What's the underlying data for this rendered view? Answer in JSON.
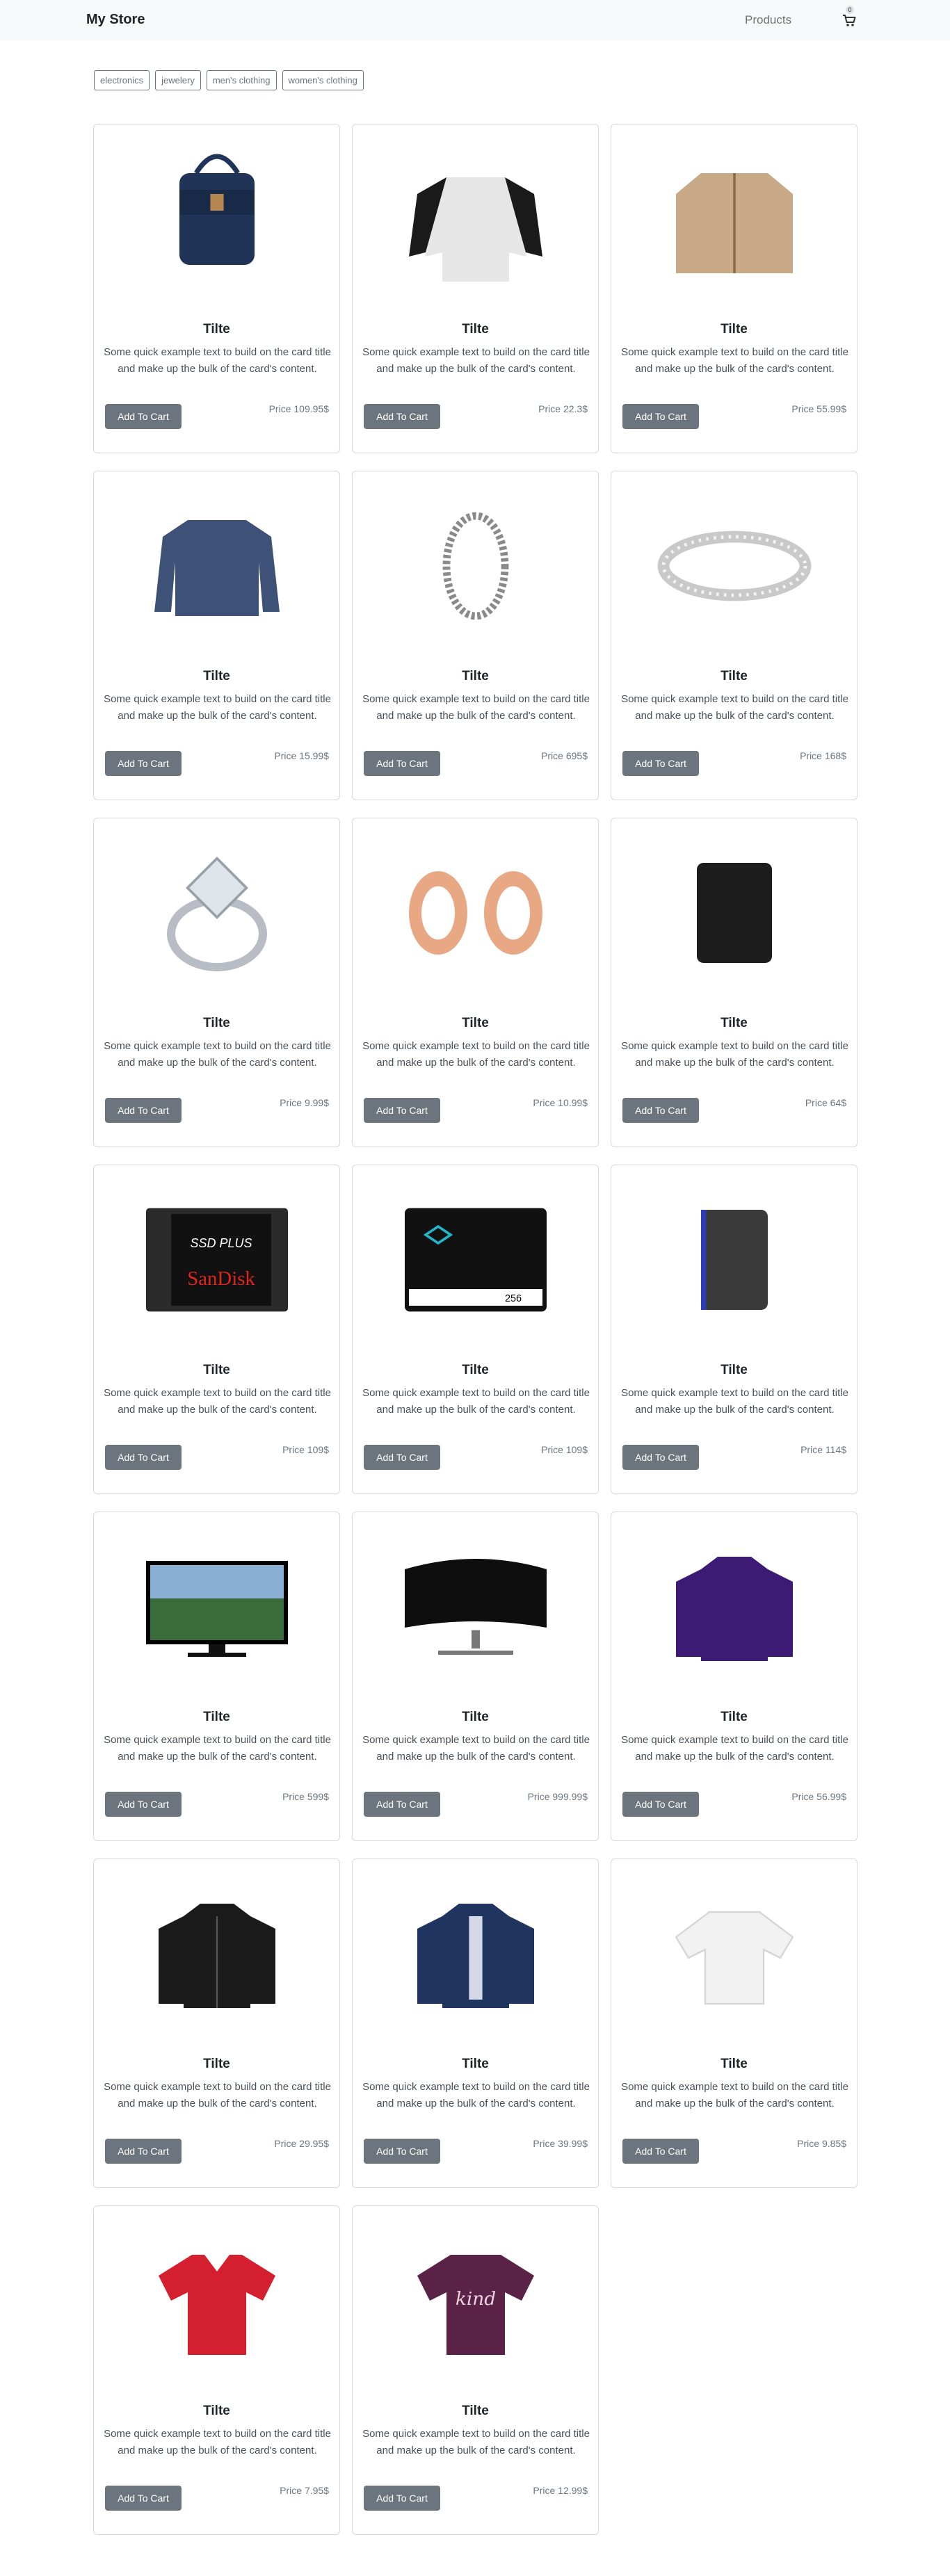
{
  "navbar": {
    "brand": "My Store",
    "products_link": "Products",
    "cart_count": "0"
  },
  "filters": [
    "electronics",
    "jewelery",
    "men's clothing",
    "women's clothing"
  ],
  "card_text": "Some quick example text to build on the card title and make up the bulk of the card's content.",
  "add_to_cart_label": "Add To Cart",
  "products": [
    {
      "title": "Tilte",
      "price": "Price 109.95$",
      "icon": "backpack",
      "color": "#1f3457"
    },
    {
      "title": "Tilte",
      "price": "Price 22.3$",
      "icon": "raglan-tshirt",
      "color": "#e6e6e6"
    },
    {
      "title": "Tilte",
      "price": "Price 55.99$",
      "icon": "cotton-jacket",
      "color": "#c8a987"
    },
    {
      "title": "Tilte",
      "price": "Price 15.99$",
      "icon": "long-sleeve-shirt",
      "color": "#3e5278"
    },
    {
      "title": "Tilte",
      "price": "Price 695$",
      "icon": "chain-bracelet",
      "color": "#8a8a8a"
    },
    {
      "title": "Tilte",
      "price": "Price 168$",
      "icon": "silver-ring",
      "color": "#c9c9c9"
    },
    {
      "title": "Tilte",
      "price": "Price 9.99$",
      "icon": "diamond-ring",
      "color": "#b8bcc4"
    },
    {
      "title": "Tilte",
      "price": "Price 10.99$",
      "icon": "rose-gold-plugs",
      "color": "#e9a884"
    },
    {
      "title": "Tilte",
      "price": "Price 64$",
      "icon": "external-hard-drive",
      "color": "#1d1d1d"
    },
    {
      "title": "Tilte",
      "price": "Price 109$",
      "icon": "ssd-drive",
      "color": "#2b2b2b"
    },
    {
      "title": "Tilte",
      "price": "Price 109$",
      "icon": "ssd-drive-dark",
      "color": "#111111"
    },
    {
      "title": "Tilte",
      "price": "Price 114$",
      "icon": "portable-drive",
      "color": "#2a3cb8"
    },
    {
      "title": "Tilte",
      "price": "Price 599$",
      "icon": "monitor",
      "color": "#3a6c3a"
    },
    {
      "title": "Tilte",
      "price": "Price 999.99$",
      "icon": "curved-monitor",
      "color": "#0e0e0e"
    },
    {
      "title": "Tilte",
      "price": "Price 56.99$",
      "icon": "purple-jacket",
      "color": "#3d1a73"
    },
    {
      "title": "Tilte",
      "price": "Price 29.95$",
      "icon": "leather-jacket",
      "color": "#1a1a1a"
    },
    {
      "title": "Tilte",
      "price": "Price 39.99$",
      "icon": "rain-jacket",
      "color": "#1f3560"
    },
    {
      "title": "Tilte",
      "price": "Price 9.85$",
      "icon": "white-top",
      "color": "#f2f2f2"
    },
    {
      "title": "Tilte",
      "price": "Price 7.95$",
      "icon": "red-tshirt",
      "color": "#d4202e"
    },
    {
      "title": "Tilte",
      "price": "Price 12.99$",
      "icon": "purple-tshirt",
      "color": "#5a2246"
    }
  ]
}
